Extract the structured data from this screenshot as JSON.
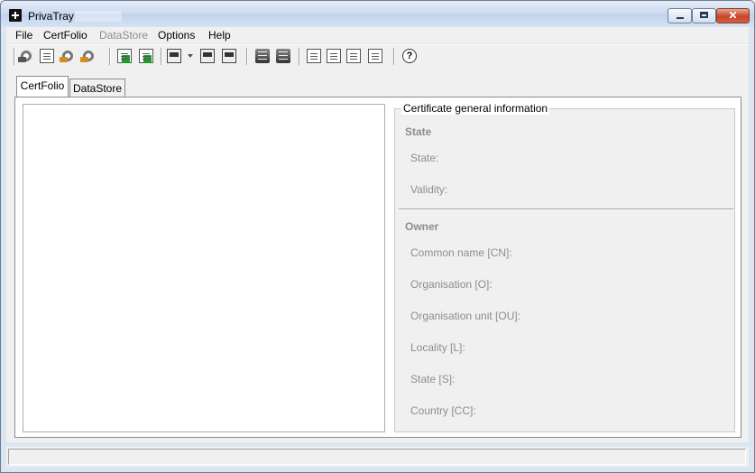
{
  "window": {
    "title": "PrivaTray"
  },
  "menu": {
    "items": [
      {
        "label": "File",
        "enabled": true
      },
      {
        "label": "CertFolio",
        "enabled": true
      },
      {
        "label": "DataStore",
        "enabled": false
      },
      {
        "label": "Options",
        "enabled": true
      },
      {
        "label": "Help",
        "enabled": true
      }
    ]
  },
  "toolbar": {
    "icons": [
      "gear-user-icon",
      "open-folder-icon",
      "gear-orange-icon",
      "gear-orange-delete-icon",
      "import-certificate-icon",
      "export-certificate-icon",
      "certificate-view-icon",
      "certificate-new-icon",
      "certificate-info-icon",
      "server-icon",
      "server-list-icon",
      "document-icon",
      "document-folder-icon",
      "document-send-icon",
      "document-lines-icon",
      "help-icon"
    ]
  },
  "tabs": [
    {
      "label": "CertFolio",
      "active": true
    },
    {
      "label": "DataStore",
      "active": false
    }
  ],
  "info": {
    "group_title": "Certificate general information",
    "state_section": "State",
    "state_fields": [
      "State:",
      "Validity:"
    ],
    "owner_section": "Owner",
    "owner_fields": [
      "Common name [CN]:",
      "Organisation [O]:",
      "Organisation unit [OU]:",
      "Locality [L]:",
      "State [S]:",
      "Country [CC]:"
    ]
  },
  "status": {
    "text": ""
  }
}
